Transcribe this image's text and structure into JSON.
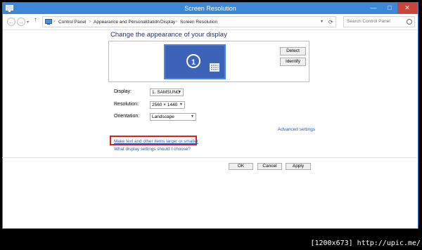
{
  "window": {
    "title": "Screen Resolution",
    "min": "—",
    "max": "□",
    "close": "✕"
  },
  "addressbar": {
    "back": "←",
    "forward": "→",
    "recent": "▾",
    "up": "↑",
    "crumbs": [
      "Control Panel",
      "Appearance and Personalization",
      "Display",
      "Screen Resolution"
    ],
    "separator": "›",
    "dropdown": "▾",
    "refresh": "⟳",
    "search_placeholder": "Search Control Panel"
  },
  "main": {
    "heading": "Change the appearance of your display",
    "monitor_number": "1",
    "detect": "Detect",
    "identify": "Identify",
    "display_label": "Display:",
    "display_value": "1. SAMSUNG",
    "resolution_label": "Resolution:",
    "resolution_value": "2560 × 1440",
    "orientation_label": "Orientation:",
    "orientation_value": "Landscape",
    "dropdown_arrow": "▼",
    "advanced": "Advanced settings",
    "text_size_link": "Make text and other items larger or smaller",
    "help_link": "What display settings should I choose?"
  },
  "footer": {
    "ok": "OK",
    "cancel": "Cancel",
    "apply": "Apply"
  },
  "watermark": "[1200x673] http://upic.me/",
  "colors": {
    "titlebar": "#3c87d8",
    "close": "#c9453b",
    "link": "#1e5db8",
    "heading": "#1e3287",
    "highlight": "#e02020",
    "monitor": "#3d63b8"
  }
}
